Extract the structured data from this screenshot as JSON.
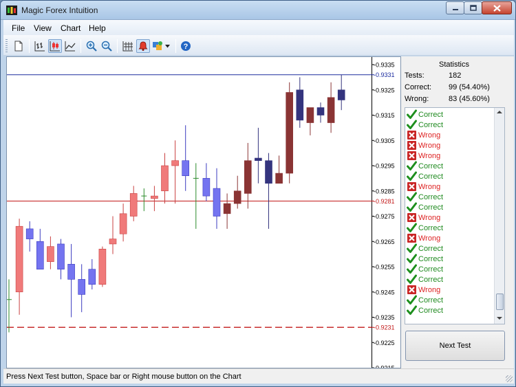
{
  "window": {
    "title": "Magic Forex Intuition",
    "colors": {
      "frame": "#bfd4ea",
      "close_button": "#c6442f"
    }
  },
  "menu": [
    {
      "id": "file",
      "label": "File"
    },
    {
      "id": "view",
      "label": "View"
    },
    {
      "id": "chart",
      "label": "Chart"
    },
    {
      "id": "help",
      "label": "Help"
    }
  ],
  "toolbar": {
    "icons": [
      "new-document-icon",
      "bar-chart-icon",
      "candlestick-chart-icon",
      "line-chart-icon",
      "zoom-in-icon",
      "zoom-out-icon",
      "grid-icon",
      "alert-bell-icon",
      "color-palette-icon",
      "dropdown-arrow-icon",
      "help-icon"
    ],
    "active": [
      "candlestick-chart-icon",
      "alert-bell-icon"
    ]
  },
  "chart_data": {
    "type": "candlestick",
    "ylim": [
      0.9215,
      0.9338
    ],
    "yticks": [
      "0.9335",
      "0.9325",
      "0.9315",
      "0.9305",
      "0.9295",
      "0.9285",
      "0.9275",
      "0.9265",
      "0.9255",
      "0.9245",
      "0.9235",
      "0.9225",
      "0.9215"
    ],
    "yticks_values": [
      0.9335,
      0.9325,
      0.9315,
      0.9305,
      0.9295,
      0.9285,
      0.9275,
      0.9265,
      0.9255,
      0.9245,
      0.9235,
      0.9225,
      0.9215
    ],
    "level_lines": [
      {
        "label": "0.9331",
        "value": 0.9331,
        "color": "#1a2a9e",
        "style": "solid"
      },
      {
        "label": "0.9281",
        "value": 0.9281,
        "color": "#c21818",
        "style": "solid"
      },
      {
        "label": "0.9231",
        "value": 0.9231,
        "color": "#c21818",
        "style": "dashed"
      }
    ],
    "candles": [
      {
        "o": 0.9242,
        "h": 0.925,
        "l": 0.9229,
        "c": 0.924,
        "color": "doji"
      },
      {
        "o": 0.9245,
        "h": 0.9274,
        "l": 0.9236,
        "c": 0.9271,
        "color": "red"
      },
      {
        "o": 0.927,
        "h": 0.9273,
        "l": 0.9261,
        "c": 0.9266,
        "color": "blue"
      },
      {
        "o": 0.9265,
        "h": 0.927,
        "l": 0.9254,
        "c": 0.9254,
        "color": "blue"
      },
      {
        "o": 0.9257,
        "h": 0.9267,
        "l": 0.9254,
        "c": 0.9263,
        "color": "red"
      },
      {
        "o": 0.9264,
        "h": 0.9266,
        "l": 0.925,
        "c": 0.9254,
        "color": "blue"
      },
      {
        "o": 0.9256,
        "h": 0.9264,
        "l": 0.9235,
        "c": 0.925,
        "color": "blue"
      },
      {
        "o": 0.925,
        "h": 0.9256,
        "l": 0.9237,
        "c": 0.9244,
        "color": "blue"
      },
      {
        "o": 0.9254,
        "h": 0.9258,
        "l": 0.9246,
        "c": 0.9248,
        "color": "blue"
      },
      {
        "o": 0.9248,
        "h": 0.9263,
        "l": 0.9247,
        "c": 0.9262,
        "color": "red"
      },
      {
        "o": 0.9264,
        "h": 0.9275,
        "l": 0.926,
        "c": 0.9266,
        "color": "red"
      },
      {
        "o": 0.9268,
        "h": 0.928,
        "l": 0.9265,
        "c": 0.9276,
        "color": "red"
      },
      {
        "o": 0.9275,
        "h": 0.9287,
        "l": 0.9273,
        "c": 0.9284,
        "color": "red"
      },
      {
        "o": 0.9283,
        "h": 0.9286,
        "l": 0.9277,
        "c": 0.9283,
        "color": "doji"
      },
      {
        "o": 0.9282,
        "h": 0.9287,
        "l": 0.9277,
        "c": 0.9283,
        "color": "red"
      },
      {
        "o": 0.9285,
        "h": 0.93,
        "l": 0.928,
        "c": 0.9295,
        "color": "red"
      },
      {
        "o": 0.9295,
        "h": 0.9305,
        "l": 0.928,
        "c": 0.9297,
        "color": "red"
      },
      {
        "o": 0.9297,
        "h": 0.9311,
        "l": 0.9285,
        "c": 0.9291,
        "color": "blue"
      },
      {
        "o": 0.929,
        "h": 0.9296,
        "l": 0.927,
        "c": 0.929,
        "color": "doji"
      },
      {
        "o": 0.929,
        "h": 0.9296,
        "l": 0.9281,
        "c": 0.9283,
        "color": "blue"
      },
      {
        "o": 0.9286,
        "h": 0.9294,
        "l": 0.927,
        "c": 0.9275,
        "color": "blue"
      },
      {
        "o": 0.9276,
        "h": 0.9284,
        "l": 0.927,
        "c": 0.928,
        "color": "brown"
      },
      {
        "o": 0.928,
        "h": 0.9291,
        "l": 0.9278,
        "c": 0.9285,
        "color": "brown"
      },
      {
        "o": 0.9284,
        "h": 0.9304,
        "l": 0.9278,
        "c": 0.9297,
        "color": "brown"
      },
      {
        "o": 0.9298,
        "h": 0.931,
        "l": 0.9288,
        "c": 0.9297,
        "color": "navy"
      },
      {
        "o": 0.9297,
        "h": 0.93,
        "l": 0.927,
        "c": 0.9288,
        "color": "navy"
      },
      {
        "o": 0.9288,
        "h": 0.9299,
        "l": 0.9288,
        "c": 0.9292,
        "color": "brown"
      },
      {
        "o": 0.9292,
        "h": 0.9328,
        "l": 0.9288,
        "c": 0.9324,
        "color": "brown"
      },
      {
        "o": 0.9325,
        "h": 0.933,
        "l": 0.931,
        "c": 0.9313,
        "color": "navy"
      },
      {
        "o": 0.9312,
        "h": 0.9317,
        "l": 0.9307,
        "c": 0.9318,
        "color": "brown"
      },
      {
        "o": 0.9318,
        "h": 0.932,
        "l": 0.9312,
        "c": 0.9315,
        "color": "navy"
      },
      {
        "o": 0.9312,
        "h": 0.9328,
        "l": 0.9308,
        "c": 0.9322,
        "color": "brown"
      },
      {
        "o": 0.9325,
        "h": 0.9331,
        "l": 0.9317,
        "c": 0.9321,
        "color": "navy"
      }
    ],
    "palette": {
      "red": "#f07a7a",
      "blue": "#7474f0",
      "brown": "#8a3434",
      "navy": "#34347e",
      "doji": "#2a8a2a",
      "wick_red": "#c94040",
      "wick_blue": "#3b3bc0"
    }
  },
  "statistics": {
    "title": "Statistics",
    "tests_label": "Tests:",
    "tests_value": "182",
    "correct_label": "Correct:",
    "correct_value": "99 (54.40%)",
    "wrong_label": "Wrong:",
    "wrong_value": "83 (45.60%)"
  },
  "results": [
    {
      "label": "Correct",
      "ok": true
    },
    {
      "label": "Correct",
      "ok": true
    },
    {
      "label": "Wrong",
      "ok": false
    },
    {
      "label": "Wrong",
      "ok": false
    },
    {
      "label": "Wrong",
      "ok": false
    },
    {
      "label": "Correct",
      "ok": true
    },
    {
      "label": "Correct",
      "ok": true
    },
    {
      "label": "Wrong",
      "ok": false
    },
    {
      "label": "Correct",
      "ok": true
    },
    {
      "label": "Correct",
      "ok": true
    },
    {
      "label": "Wrong",
      "ok": false
    },
    {
      "label": "Correct",
      "ok": true
    },
    {
      "label": "Wrong",
      "ok": false
    },
    {
      "label": "Correct",
      "ok": true
    },
    {
      "label": "Correct",
      "ok": true
    },
    {
      "label": "Correct",
      "ok": true
    },
    {
      "label": "Correct",
      "ok": true
    },
    {
      "label": "Wrong",
      "ok": false
    },
    {
      "label": "Correct",
      "ok": true
    },
    {
      "label": "Correct",
      "ok": true
    }
  ],
  "next_button_label": "Next Test",
  "status_text": "Press Next Test button, Space bar or Right mouse button on the Chart"
}
